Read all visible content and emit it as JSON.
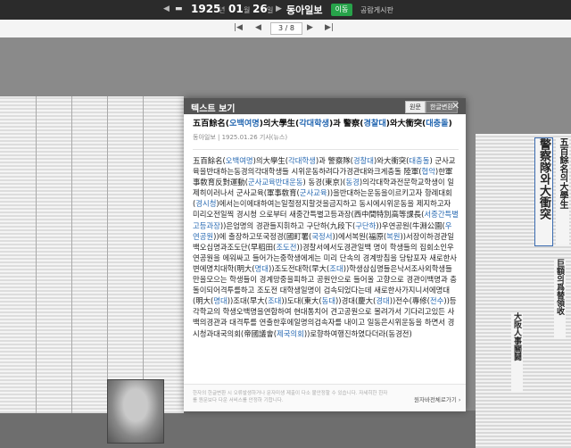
{
  "toolbar": {
    "year": "1925",
    "year_unit": "년",
    "month": "01",
    "month_unit": "월",
    "day": "26",
    "day_unit": "일",
    "newspaper": "동아일보",
    "go_label": "이동",
    "board_link": "공람게시판"
  },
  "pager": {
    "page_current": "3",
    "page_total": "8",
    "separator": "/"
  },
  "newspaper_headlines": {
    "right_1": "五百餘名의大學生",
    "right_2": "警察隊와大衝突",
    "right_3": "巨額의爲替領收",
    "right_4": "大阪人事關鬪"
  },
  "dialog": {
    "title": "텍스트 보기",
    "btn_original": "원문",
    "btn_convert": "한글변환",
    "article_title_parts": [
      {
        "t": "五百餘名(",
        "h": false
      },
      {
        "t": "오백여명",
        "h": true
      },
      {
        "t": ")의大學生(",
        "h": false
      },
      {
        "t": "각대학생",
        "h": true
      },
      {
        "t": ")과 警察(",
        "h": false
      },
      {
        "t": "경찰대",
        "h": true
      },
      {
        "t": ")와大衝突(",
        "h": false
      },
      {
        "t": "대충돌",
        "h": true
      },
      {
        "t": ")",
        "h": false
      }
    ],
    "subtitle": "동아일보 | 1925.01.26 기사(뉴스)",
    "body_parts": [
      {
        "t": "五百餘名(",
        "h": false
      },
      {
        "t": "오백여명",
        "h": true
      },
      {
        "t": ")의大學生(",
        "h": false
      },
      {
        "t": "각대학생",
        "h": true
      },
      {
        "t": ")과 警察隊(",
        "h": false
      },
      {
        "t": "경찰대",
        "h": true
      },
      {
        "t": ")와大衝突(",
        "h": false
      },
      {
        "t": "대충돌",
        "h": true
      },
      {
        "t": ") 군사교육을반대하는동경의각대학생들 시위운동하려다가경관대와크게충돌 陸軍(",
        "h": false
      },
      {
        "t": "협악",
        "h": true
      },
      {
        "t": ")한軍事敎育反對運動(",
        "h": false
      },
      {
        "t": "군사교육반대운동",
        "h": true
      },
      {
        "t": ") 동경(東京)(",
        "h": false
      },
      {
        "t": "동경",
        "h": true
      },
      {
        "t": ")의각대학과전문학교학생이 일제히이러나서 군사교육(軍事敎育(",
        "h": false
      },
      {
        "t": "군사교육",
        "h": true
      },
      {
        "t": "))을반대하는운동을이르키고자 항례대회(",
        "h": false
      },
      {
        "t": "경시청",
        "h": true
      },
      {
        "t": ")에서는이에대하여는일절정지할것을금지하고 동시에시위운동을 제지하고자 미리오전일찍 경시청 으로부터 새중간특별고등과장(西中間特別高等課長(",
        "h": false
      },
      {
        "t": "서중간특별고등과장",
        "h": true
      },
      {
        "t": "))은엄명의 경관들지휘하고 구단하(九段下(",
        "h": false
      },
      {
        "t": "구단하",
        "h": true
      },
      {
        "t": "))우연공원(牛淵公園(",
        "h": false
      },
      {
        "t": "우연공원",
        "h": true
      },
      {
        "t": "))에 출장하고또국정경(國町署(",
        "h": false
      },
      {
        "t": "국정서",
        "h": true
      },
      {
        "t": "))에서복원(福原(",
        "h": false
      },
      {
        "t": "복원",
        "h": true
      },
      {
        "t": "))서장이하경관일백오십명과조도단(早稻田(",
        "h": false
      },
      {
        "t": "조도전",
        "h": true
      },
      {
        "t": "))경찰서에서도경관일백 명이 학생들의 집회소인우연공원을 에워싸고 들어가는중학생에게는 미리 단속의 경계방침을 당탐포자 새로한사변에명치대학(明大(",
        "h": false
      },
      {
        "t": "명대",
        "h": true
      },
      {
        "t": "))조도전대학(早大(",
        "h": false
      },
      {
        "t": "조대",
        "h": true
      },
      {
        "t": "))학생삼십명들은낙서조사외학생들만을모으는 학생들이 경계망중을피하고 공원안으로 들어올 고향으로 경관이백명과 충돌이되어격투를하고 조도전 대학생일명이 검속되었다는데 새로한사가지니서에명대(明大(",
        "h": false
      },
      {
        "t": "명대",
        "h": true
      },
      {
        "t": "))조대(早大(",
        "h": false
      },
      {
        "t": "조대",
        "h": true
      },
      {
        "t": "))도대(東大(",
        "h": false
      },
      {
        "t": "동대",
        "h": true
      },
      {
        "t": "))경대(慶大(",
        "h": false
      },
      {
        "t": "경대",
        "h": true
      },
      {
        "t": "))전수(專修(",
        "h": false
      },
      {
        "t": "전수",
        "h": true
      },
      {
        "t": "))등각학교의 학생오백명을연합하여 현대통치어 견고공원으로 몰려가서 기다리고있든 사백의경관과 대격투를 연출한후에일명의검속자를 내이고 일동은시위운동을 하면서 경시청과대국의회(帝國議會(",
        "h": false
      },
      {
        "t": "제국의회",
        "h": true
      },
      {
        "t": "))로향하여행진하였다더라(동경전)",
        "h": false
      }
    ],
    "footer_note": "한자의 한글변환 시 오류발생하거나 문자미생 제출이 다소 불안정할 수 있습니다. 자세히한 한자를 원문보다 다운 서비스를 안정하 기합니다.",
    "footer_link": "원자바전체로가기 ›"
  }
}
